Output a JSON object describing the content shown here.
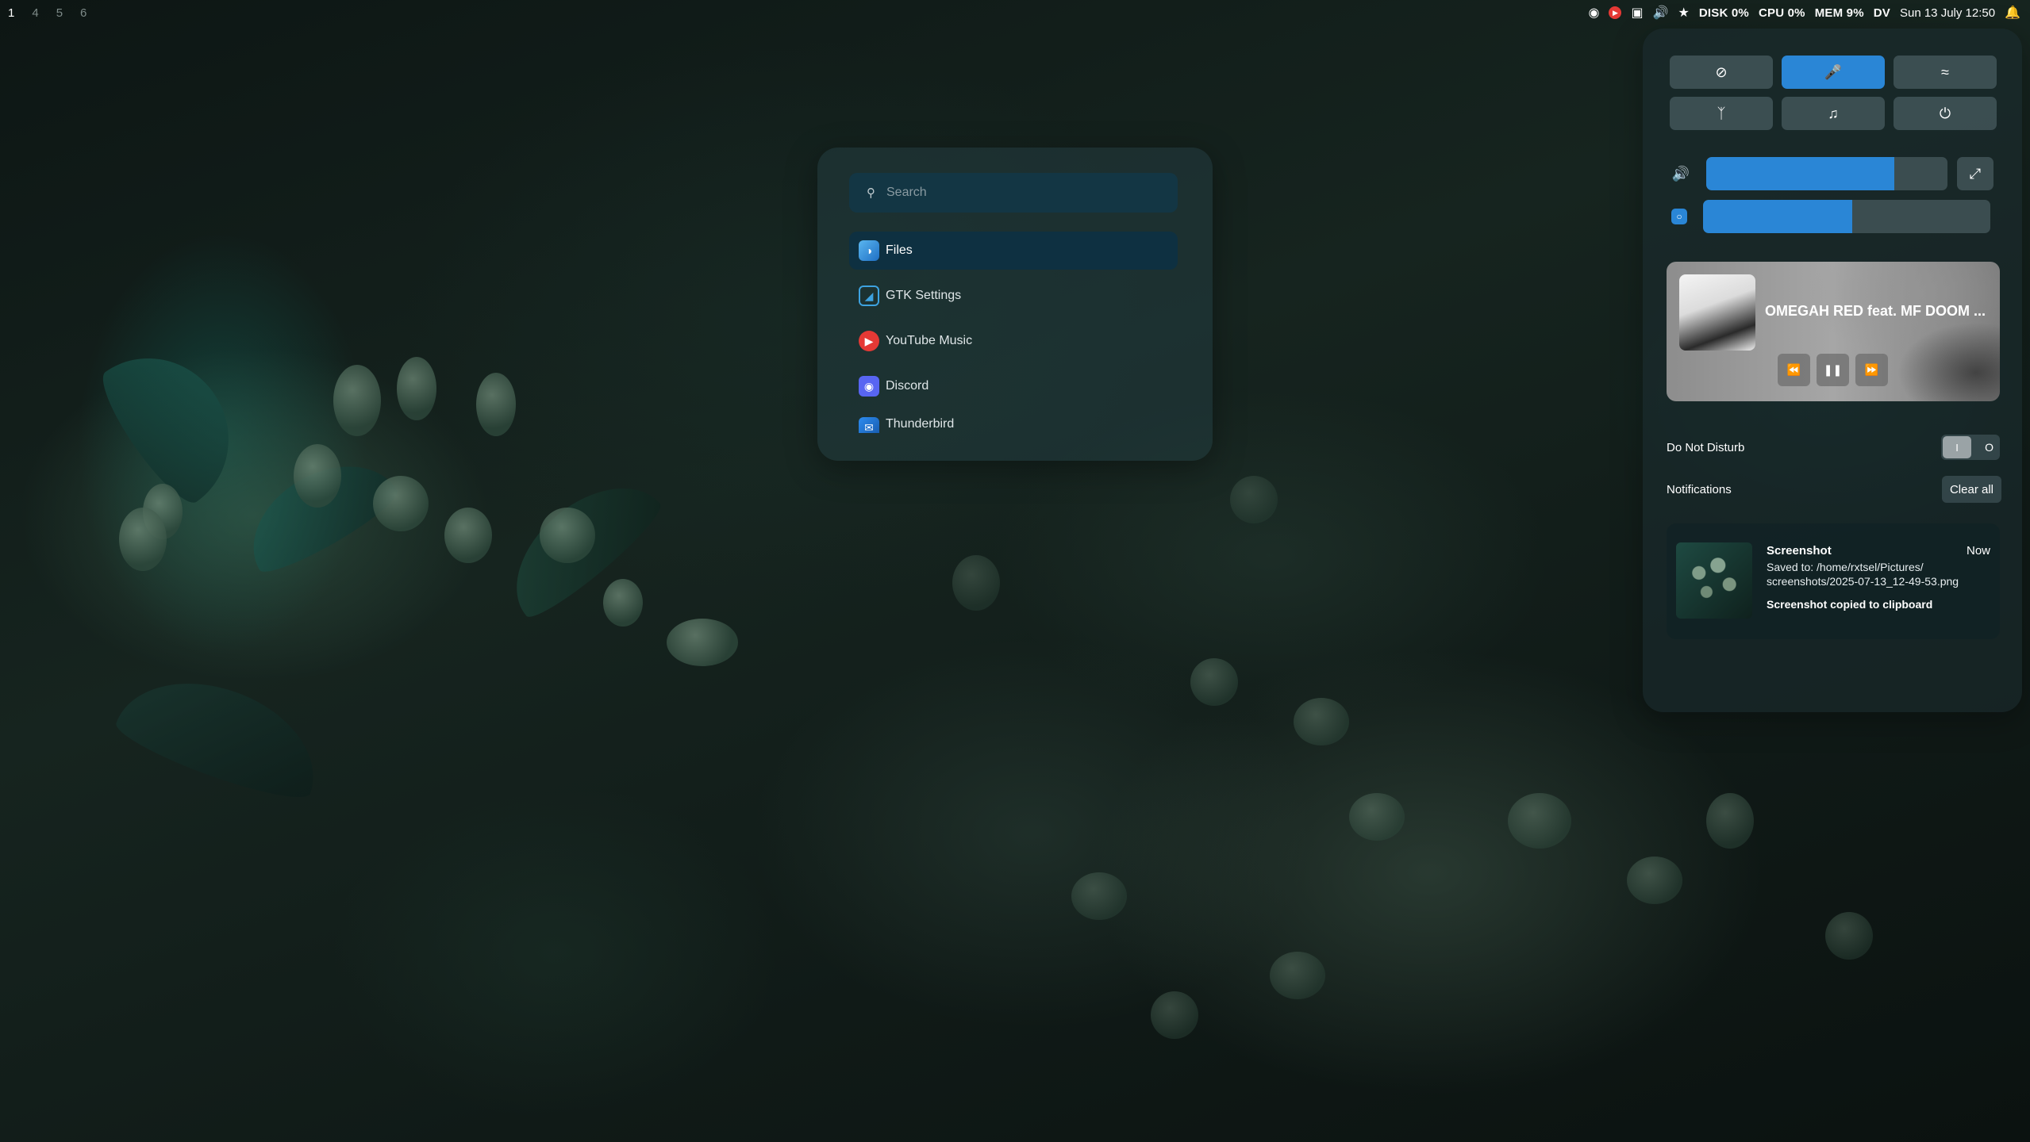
{
  "topbar": {
    "workspaces": [
      "1",
      "4",
      "5",
      "6"
    ],
    "active_workspace": "1",
    "tray_icons": [
      "discord-icon",
      "youtube-music-icon",
      "robot-icon",
      "volume-icon",
      "network-icon"
    ],
    "disk": "DISK 0%",
    "cpu": "CPU 0%",
    "mem": "MEM 9%",
    "keyboard_layout": "DV",
    "clock": "Sun 13 July 12:50"
  },
  "launcher": {
    "search_placeholder": "Search",
    "apps": [
      {
        "label": "Files",
        "icon": "files-icon",
        "selected": true
      },
      {
        "label": "GTK Settings",
        "icon": "gtk-settings-icon",
        "selected": false
      },
      {
        "label": "YouTube Music",
        "icon": "youtube-music-icon",
        "selected": false
      },
      {
        "label": "Discord",
        "icon": "discord-icon",
        "selected": false
      },
      {
        "label": "Thunderbird",
        "icon": "thunderbird-icon",
        "selected": false
      }
    ]
  },
  "control_center": {
    "quick_settings": [
      {
        "icon": "night-light-off-icon",
        "active": false
      },
      {
        "icon": "microphone-icon",
        "active": true
      },
      {
        "icon": "wifi-icon",
        "active": false
      },
      {
        "icon": "bluetooth-icon",
        "active": false
      },
      {
        "icon": "music-note-icon",
        "active": false
      },
      {
        "icon": "power-icon",
        "active": false
      }
    ],
    "volume_level": 0.78,
    "brightness_level": 0.52,
    "media": {
      "title": "OMEGAH RED feat. MF DOOM ...",
      "state": "playing"
    },
    "dnd_label": "Do Not Disturb",
    "dnd_on_symbol": "I",
    "dnd_off_symbol": "O",
    "notifications_label": "Notifications",
    "clear_all_label": "Clear all",
    "notifications": [
      {
        "app": "Screenshot",
        "time": "Now",
        "body": "Saved to: /home/rxtsel/Pictures/ screenshots/2025-07-13_12-49-53.png",
        "extra": "Screenshot copied to clipboard"
      }
    ]
  },
  "colors": {
    "accent": "#2a86d6",
    "youtube_red": "#e53935",
    "discord": "#5865f2"
  }
}
